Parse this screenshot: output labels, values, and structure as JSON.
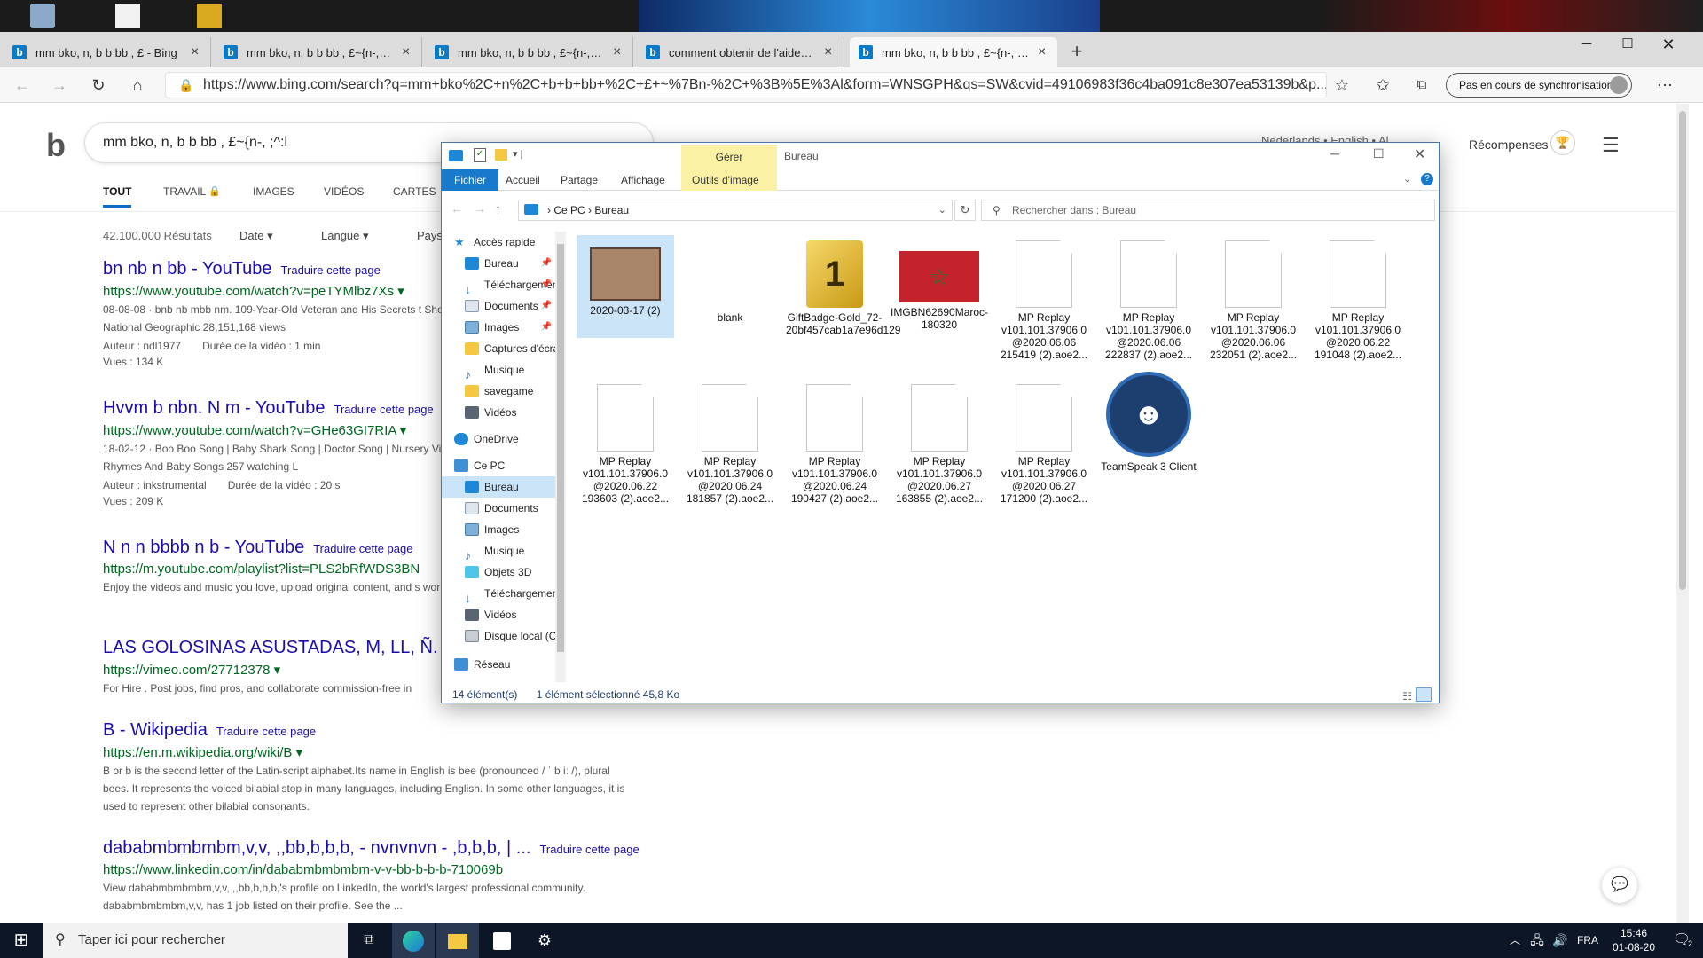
{
  "browser": {
    "tabs": [
      {
        "title": "mm bko, n, b b bb , £ - Bing"
      },
      {
        "title": "mm bko, n, b b bb , £~{n-, ;^:l -"
      },
      {
        "title": "mm bko, n, b b bb , £~{n-, ;^:l -"
      },
      {
        "title": "comment obtenir de l'aide dans"
      },
      {
        "title": "mm bko, n, b b bb , £~{n-, ;^:l -"
      }
    ],
    "new_tab": "+",
    "url": "https://www.bing.com/search?q=mm+bko%2C+n%2C+b+b+bb+%2C+£+~%7Bn-%2C+%3B%5E%3Al&form=WNSGPH&qs=SW&cvid=49106983f36c4ba091c8e307ea53139b&p...",
    "sync_label": "Pas en cours de synchronisation"
  },
  "bing": {
    "query": "mm bko, n, b b bb , £~{n-, ;^:l",
    "nav": [
      "TOUT",
      "TRAVAIL",
      "IMAGES",
      "VIDÉOS",
      "CARTES"
    ],
    "rewards": "Récompenses",
    "partial_right": "Nederlands • English • Al",
    "result_count": "42.100.000 Résultats",
    "filters": [
      "Date",
      "Langue",
      "Pays"
    ],
    "translate": "Traduire cette page",
    "results": [
      {
        "title": "bn nb n bb - YouTube",
        "url": "https://www.youtube.com/watch?v=peTYMlbz7Xs",
        "desc": "08-08-08 · bnb nb mbb nm. 109-Year-Old Veteran and His Secrets t Showcase - Duration: 12:39. National Geographic 28,151,168 views",
        "meta1": "Auteur : ndl1977",
        "meta2": "Durée de la vidéo : 1 min",
        "views": "Vues : 134 K"
      },
      {
        "title": "Hvvm b nbn. N m - YouTube",
        "url": "https://www.youtube.com/watch?v=GHe63GI7RIA",
        "desc": "18-02-12 · Boo Boo Song | Baby Shark Song | Doctor Song | Nursery Videos Kids TV - Nursery Rhymes And Baby Songs 257 watching L",
        "meta1": "Auteur : inkstrumental",
        "meta2": "Durée de la vidéo : 20 s",
        "views": "Vues : 209 K"
      },
      {
        "title": "N n n bbbb n b - YouTube",
        "url": "https://m.youtube.com/playlist?list=PLS2bRfWDS3BN",
        "desc": "Enjoy the videos and music you love, upload original content, and s world on YouTube."
      },
      {
        "title": "LAS GOLOSINAS ASUSTADAS, M, LL, Ñ. on",
        "url": "https://vimeo.com/27712378",
        "desc": "For Hire . Post jobs, find pros, and collaborate commission-free in"
      },
      {
        "title": "B - Wikipedia",
        "url": "https://en.m.wikipedia.org/wiki/B",
        "desc": "B or b is the second letter of the Latin-script alphabet.Its name in English is bee (pronounced / ˈ b iː /), plural bees. It represents the voiced bilabial stop in many languages, including English. In some other languages, it is used to represent other bilabial consonants."
      },
      {
        "title": "dababmbmbmbm,v,v, ,,bb,b,b,b, - nvnvnvn - ,b,b,b, | ...",
        "url": "https://www.linkedin.com/in/dababmbmbmbm-v-v-bb-b-b-b-710069b",
        "desc": "View dababmbmbmbm,v,v, ,,bb,b,b,b,'s profile on LinkedIn, the world's largest professional community. dababmbmbmbm,v,v, has 1 job listed on their profile. See the ..."
      }
    ]
  },
  "explorer": {
    "title": "Bureau",
    "manage_tab": "Gérer",
    "ribbon": [
      "Fichier",
      "Accueil",
      "Partage",
      "Affichage",
      "Outils d'image"
    ],
    "breadcrumb": [
      "Ce PC",
      "Bureau"
    ],
    "search_placeholder": "Rechercher dans : Bureau",
    "nav": [
      {
        "label": "Accès rapide",
        "level": 0
      },
      {
        "label": "Bureau",
        "level": 1,
        "pin": true
      },
      {
        "label": "Téléchargements",
        "level": 1,
        "pin": true
      },
      {
        "label": "Documents",
        "level": 1,
        "pin": true
      },
      {
        "label": "Images",
        "level": 1,
        "pin": true
      },
      {
        "label": "Captures d'écran",
        "level": 1
      },
      {
        "label": "Musique",
        "level": 1
      },
      {
        "label": "savegame",
        "level": 1
      },
      {
        "label": "Vidéos",
        "level": 1
      },
      {
        "label": "OneDrive",
        "level": 0
      },
      {
        "label": "Ce PC",
        "level": 0
      },
      {
        "label": "Bureau",
        "level": 1,
        "selected": true
      },
      {
        "label": "Documents",
        "level": 1
      },
      {
        "label": "Images",
        "level": 1
      },
      {
        "label": "Musique",
        "level": 1
      },
      {
        "label": "Objets 3D",
        "level": 1
      },
      {
        "label": "Téléchargements",
        "level": 1
      },
      {
        "label": "Vidéos",
        "level": 1
      },
      {
        "label": "Disque local (C:)",
        "level": 1
      },
      {
        "label": "Réseau",
        "level": 0
      }
    ],
    "files": [
      {
        "name": "2020-03-17 (2)",
        "kind": "image-table",
        "selected": true
      },
      {
        "name": "blank",
        "kind": "blank"
      },
      {
        "name": "GiftBadge-Gold_72-20bf457cab1a7e96d129",
        "kind": "gift"
      },
      {
        "name": "IMGBN62690Maroc-180320",
        "kind": "flag"
      },
      {
        "name": "MP Replay v101.101.37906.0 @2020.06.06 215419 (2).aoe2...",
        "kind": "doc"
      },
      {
        "name": "MP Replay v101.101.37906.0 @2020.06.06 222837 (2).aoe2...",
        "kind": "doc"
      },
      {
        "name": "MP Replay v101.101.37906.0 @2020.06.06 232051 (2).aoe2...",
        "kind": "doc"
      },
      {
        "name": "MP Replay v101.101.37906.0 @2020.06.22 191048 (2).aoe2...",
        "kind": "doc"
      },
      {
        "name": "MP Replay v101.101.37906.0 @2020.06.22 193603 (2).aoe2...",
        "kind": "doc"
      },
      {
        "name": "MP Replay v101.101.37906.0 @2020.06.24 181857 (2).aoe2...",
        "kind": "doc"
      },
      {
        "name": "MP Replay v101.101.37906.0 @2020.06.24 190427 (2).aoe2...",
        "kind": "doc"
      },
      {
        "name": "MP Replay v101.101.37906.0 @2020.06.27 163855 (2).aoe2...",
        "kind": "doc"
      },
      {
        "name": "MP Replay v101.101.37906.0 @2020.06.27 171200 (2).aoe2...",
        "kind": "doc"
      },
      {
        "name": "TeamSpeak 3 Client",
        "kind": "teamspeak"
      }
    ],
    "status_count": "14 élément(s)",
    "status_selected": "1 élément sélectionné  45,8 Ko"
  },
  "taskbar": {
    "search_placeholder": "Taper ici pour rechercher",
    "lang": "FRA",
    "time": "15:46",
    "date": "01-08-20",
    "notif_count": "2"
  }
}
